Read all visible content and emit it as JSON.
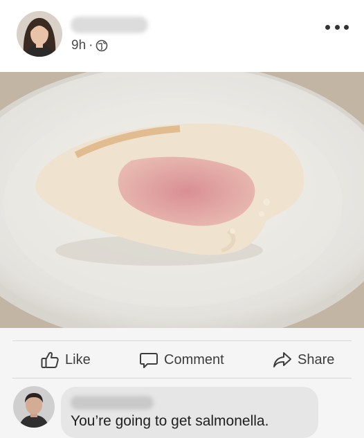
{
  "post": {
    "time": "9h",
    "separator": "·",
    "visibility_icon": "globe-icon",
    "more_icon": "more-horizontal-icon"
  },
  "actions": {
    "like": "Like",
    "comment": "Comment",
    "share": "Share"
  },
  "comment": {
    "text": "You’re going to get salmonella."
  },
  "colors": {
    "background": "#f5f5f5",
    "bubble": "#e6e6e6",
    "text": "#3c3c3c"
  }
}
